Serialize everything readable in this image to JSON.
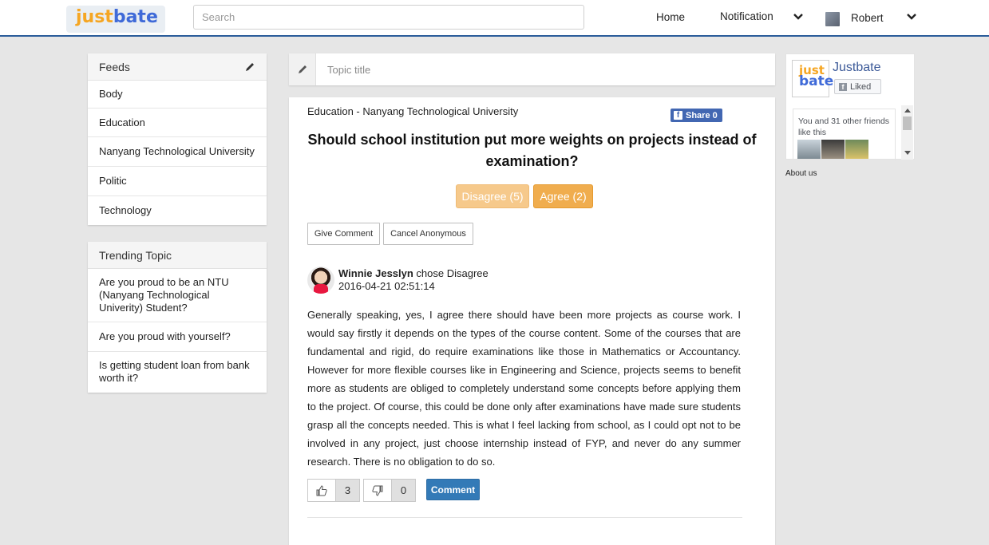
{
  "header": {
    "logo_just": "just",
    "logo_bate": "bate",
    "search_placeholder": "Search",
    "nav_home": "Home",
    "nav_notification": "Notification",
    "user_name": "Robert"
  },
  "feeds": {
    "title": "Feeds",
    "items": [
      "Body",
      "Education",
      "Nanyang Technological University",
      "Politic",
      "Technology"
    ]
  },
  "trending": {
    "title": "Trending Topic",
    "items": [
      "Are you proud to be an NTU (Nanyang Technological Univerity) Student?",
      "Are you proud with yourself?",
      "Is getting student loan from bank worth it?"
    ]
  },
  "topic": {
    "placeholder": "Topic title"
  },
  "post": {
    "breadcrumb": "Education - Nanyang Technological University",
    "share_label": "Share 0",
    "title": "Should school institution put more weights on projects instead of examination?",
    "disagree_label": "Disagree (5)",
    "agree_label": "Agree (2)",
    "give_comment_label": "Give Comment",
    "cancel_anonymous_label": "Cancel Anonymous"
  },
  "comment": {
    "author": "Winnie Jesslyn",
    "action": " chose Disagree",
    "timestamp": "2016-04-21 02:51:14",
    "body": "Generally speaking, yes, I agree there should have been more projects as course work. I would say firstly it depends on the types of the course content. Some of the courses that are fundamental and rigid, do require examinations like those in Mathematics or Accountancy. However for more flexible courses like in Engineering and Science, projects seems to benefit more as students are obliged to completely understand some concepts before applying them to the project. Of course, this could be done only after examinations have made sure students grasp all the concepts needed. This is what I feel lacking from school, as I could opt not to be involved in any project, just choose internship instead of FYP, and never do any summer research. There is no obligation to do so.",
    "like_count": "3",
    "dislike_count": "0",
    "comment_button": "Comment"
  },
  "fb_widget": {
    "logo_just": "just",
    "logo_bate": "bate",
    "page_name": "Justbate",
    "liked_label": "Liked",
    "friends_text": "You and 31 other friends like this"
  },
  "footer": {
    "about": "About us"
  },
  "colors": {
    "brand_blue": "#2a5c9a",
    "agree_orange": "#f0ad4e",
    "disagree_orange_light": "#f6c98b",
    "comment_blue": "#337ab7",
    "facebook_blue": "#4267b2"
  }
}
